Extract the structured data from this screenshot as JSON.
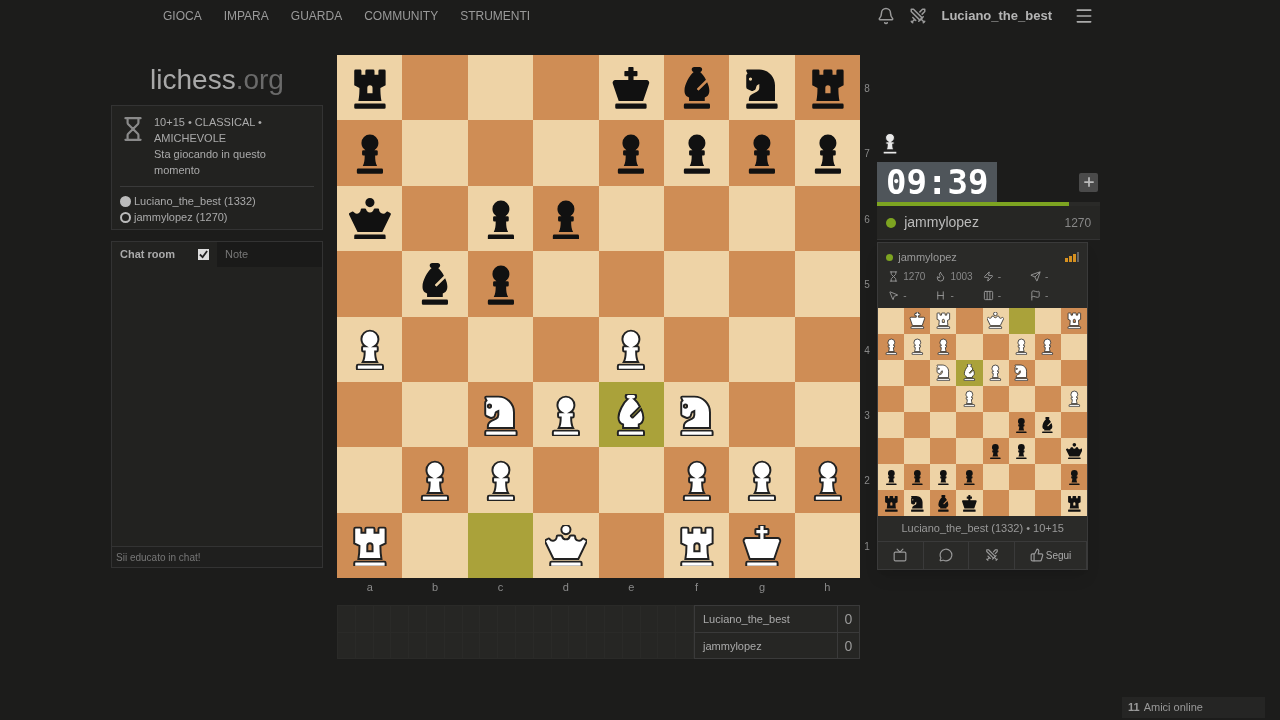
{
  "nav": {
    "links": [
      "GIOCA",
      "IMPARA",
      "GUARDA",
      "COMMUNITY",
      "STRUMENTI"
    ],
    "username": "Luciano_the_best"
  },
  "logo": {
    "name": "lichess",
    "tld": ".org"
  },
  "game_info": {
    "title": "10+15 • CLASSICAL • AMICHEVOLE",
    "status": "Sta giocando in questo momento",
    "players": [
      {
        "name": "Luciano_the_best (1332)",
        "white": true
      },
      {
        "name": "jammylopez (1270)",
        "white": false
      }
    ]
  },
  "chat": {
    "tabs": [
      {
        "label": "Chat room",
        "selected": true,
        "checked": true
      },
      {
        "label": "Note",
        "selected": false
      }
    ],
    "placeholder": "Sii educato in chat!"
  },
  "board": {
    "ranks": [
      [
        {
          "kind": "rook",
          "white": false,
          "highlighted": false
        },
        {
          "highlighted": false
        },
        {
          "highlighted": false
        },
        {
          "highlighted": false
        },
        {
          "kind": "king",
          "white": false,
          "highlighted": false
        },
        {
          "kind": "bishop",
          "white": false,
          "highlighted": false
        },
        {
          "kind": "knight",
          "white": false,
          "highlighted": false
        },
        {
          "kind": "rook",
          "white": false,
          "highlighted": false
        }
      ],
      [
        {
          "kind": "pawn",
          "white": false,
          "highlighted": false
        },
        {
          "highlighted": false
        },
        {
          "highlighted": false
        },
        {
          "highlighted": false
        },
        {
          "kind": "pawn",
          "white": false,
          "highlighted": false
        },
        {
          "kind": "pawn",
          "white": false,
          "highlighted": false
        },
        {
          "kind": "pawn",
          "white": false,
          "highlighted": false
        },
        {
          "kind": "pawn",
          "white": false,
          "highlighted": false
        }
      ],
      [
        {
          "kind": "queen",
          "white": false,
          "highlighted": false
        },
        {
          "highlighted": false
        },
        {
          "kind": "pawn",
          "white": false,
          "highlighted": false
        },
        {
          "kind": "pawn",
          "white": false,
          "highlighted": false
        },
        {
          "highlighted": false
        },
        {
          "highlighted": false
        },
        {
          "highlighted": false
        },
        {
          "highlighted": false
        }
      ],
      [
        {
          "highlighted": false
        },
        {
          "kind": "bishop",
          "white": false,
          "highlighted": false
        },
        {
          "kind": "pawn",
          "white": false,
          "highlighted": false
        },
        {
          "highlighted": false
        },
        {
          "highlighted": false
        },
        {
          "highlighted": false
        },
        {
          "highlighted": false
        },
        {
          "highlighted": false
        }
      ],
      [
        {
          "kind": "pawn",
          "white": true,
          "highlighted": false
        },
        {
          "highlighted": false
        },
        {
          "highlighted": false
        },
        {
          "highlighted": false
        },
        {
          "kind": "pawn",
          "white": true,
          "highlighted": false
        },
        {
          "highlighted": false
        },
        {
          "highlighted": false
        },
        {
          "highlighted": false
        }
      ],
      [
        {
          "highlighted": false
        },
        {
          "highlighted": false
        },
        {
          "kind": "knight",
          "white": true,
          "highlighted": false
        },
        {
          "kind": "pawn",
          "white": true,
          "highlighted": false
        },
        {
          "kind": "bishop",
          "white": true,
          "highlighted": true
        },
        {
          "kind": "knight",
          "white": true,
          "highlighted": false
        },
        {
          "highlighted": false
        },
        {
          "highlighted": false
        }
      ],
      [
        {
          "highlighted": false
        },
        {
          "kind": "pawn",
          "white": true,
          "highlighted": false
        },
        {
          "kind": "pawn",
          "white": true,
          "highlighted": false
        },
        {
          "highlighted": false
        },
        {
          "highlighted": false
        },
        {
          "kind": "pawn",
          "white": true,
          "highlighted": false
        },
        {
          "kind": "pawn",
          "white": true,
          "highlighted": false
        },
        {
          "kind": "pawn",
          "white": true,
          "highlighted": false
        }
      ],
      [
        {
          "kind": "rook",
          "white": true,
          "highlighted": false
        },
        {
          "highlighted": false
        },
        {
          "highlighted": true
        },
        {
          "kind": "queen",
          "white": true,
          "highlighted": false
        },
        {
          "highlighted": false
        },
        {
          "kind": "rook",
          "white": true,
          "highlighted": false
        },
        {
          "kind": "king",
          "white": true,
          "highlighted": false
        },
        {
          "highlighted": false
        }
      ]
    ],
    "rank_labels": [
      "8",
      "7",
      "6",
      "5",
      "4",
      "3",
      "2",
      "1"
    ],
    "file_labels": [
      "a",
      "b",
      "c",
      "d",
      "e",
      "f",
      "g",
      "h"
    ]
  },
  "score_table": [
    {
      "name": "Luciano_the_best",
      "score": "0"
    },
    {
      "name": "jammylopez",
      "score": "0"
    }
  ],
  "captured": [
    {
      "kind": "pawn",
      "white": true
    }
  ],
  "clock": {
    "time": "09:39",
    "level": 0.86
  },
  "opponent": {
    "name": "jammylopez",
    "rating": "1270",
    "online": true
  },
  "popup": {
    "name": "jammylopez",
    "online": true,
    "stats": [
      {
        "kind": "hourglass",
        "value": "1270"
      },
      {
        "kind": "flame",
        "value": "1003"
      },
      {
        "kind": "bolt",
        "value": "-"
      },
      {
        "kind": "plane",
        "value": "-"
      },
      {
        "kind": "pointer",
        "value": "-"
      },
      {
        "kind": "heading",
        "value": "-"
      },
      {
        "kind": "columns",
        "value": "-"
      },
      {
        "kind": "flag",
        "value": "-"
      }
    ],
    "board": [
      [
        {
          "highlighted": false
        },
        {
          "kind": "king",
          "white": true,
          "highlighted": false
        },
        {
          "kind": "rook",
          "white": true,
          "highlighted": false
        },
        {
          "highlighted": false
        },
        {
          "kind": "queen",
          "white": true,
          "highlighted": false
        },
        {
          "highlighted": true
        },
        {
          "highlighted": false
        },
        {
          "kind": "rook",
          "white": true,
          "highlighted": false
        }
      ],
      [
        {
          "kind": "pawn",
          "white": true,
          "highlighted": false
        },
        {
          "kind": "pawn",
          "white": true,
          "highlighted": false
        },
        {
          "kind": "pawn",
          "white": true,
          "highlighted": false
        },
        {
          "highlighted": false
        },
        {
          "highlighted": false
        },
        {
          "kind": "pawn",
          "white": true,
          "highlighted": false
        },
        {
          "kind": "pawn",
          "white": true,
          "highlighted": false
        },
        {
          "highlighted": false
        }
      ],
      [
        {
          "highlighted": false
        },
        {
          "highlighted": false
        },
        {
          "kind": "knight",
          "white": true,
          "highlighted": false
        },
        {
          "kind": "bishop",
          "white": true,
          "highlighted": true
        },
        {
          "kind": "pawn",
          "white": true,
          "highlighted": false
        },
        {
          "kind": "knight",
          "white": true,
          "highlighted": false
        },
        {
          "highlighted": false
        },
        {
          "highlighted": false
        }
      ],
      [
        {
          "highlighted": false
        },
        {
          "highlighted": false
        },
        {
          "highlighted": false
        },
        {
          "kind": "pawn",
          "white": true,
          "highlighted": false
        },
        {
          "highlighted": false
        },
        {
          "highlighted": false
        },
        {
          "highlighted": false
        },
        {
          "kind": "pawn",
          "white": true,
          "highlighted": false
        }
      ],
      [
        {
          "highlighted": false
        },
        {
          "highlighted": false
        },
        {
          "highlighted": false
        },
        {
          "highlighted": false
        },
        {
          "highlighted": false
        },
        {
          "kind": "pawn",
          "white": false,
          "highlighted": false
        },
        {
          "kind": "bishop",
          "white": false,
          "highlighted": false
        },
        {
          "highlighted": false
        }
      ],
      [
        {
          "highlighted": false
        },
        {
          "highlighted": false
        },
        {
          "highlighted": false
        },
        {
          "highlighted": false
        },
        {
          "kind": "pawn",
          "white": false,
          "highlighted": false
        },
        {
          "kind": "pawn",
          "white": false,
          "highlighted": false
        },
        {
          "highlighted": false
        },
        {
          "kind": "queen",
          "white": false,
          "highlighted": false
        }
      ],
      [
        {
          "kind": "pawn",
          "white": false,
          "highlighted": false
        },
        {
          "kind": "pawn",
          "white": false,
          "highlighted": false
        },
        {
          "kind": "pawn",
          "white": false,
          "highlighted": false
        },
        {
          "kind": "pawn",
          "white": false,
          "highlighted": false
        },
        {
          "highlighted": false
        },
        {
          "highlighted": false
        },
        {
          "highlighted": false
        },
        {
          "kind": "pawn",
          "white": false,
          "highlighted": false
        }
      ],
      [
        {
          "kind": "rook",
          "white": false,
          "highlighted": false
        },
        {
          "kind": "knight",
          "white": false,
          "highlighted": false
        },
        {
          "kind": "bishop",
          "white": false,
          "highlighted": false
        },
        {
          "kind": "king",
          "white": false,
          "highlighted": false
        },
        {
          "highlighted": false
        },
        {
          "highlighted": false
        },
        {
          "highlighted": false
        },
        {
          "kind": "rook",
          "white": false,
          "highlighted": false
        }
      ]
    ],
    "caption": "Luciano_the_best (1332) • 10+15",
    "actions": [
      {
        "kind": "tv"
      },
      {
        "kind": "chat"
      },
      {
        "kind": "swords"
      },
      {
        "kind": "follow",
        "label": "Segui"
      }
    ]
  },
  "friends": {
    "count": "11",
    "label": "Amici online"
  }
}
